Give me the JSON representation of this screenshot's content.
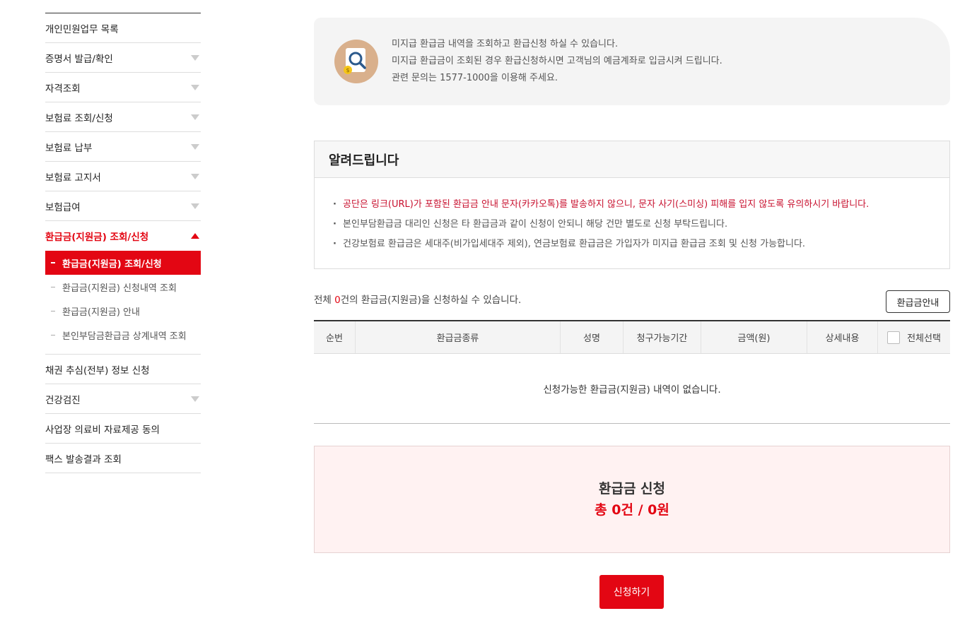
{
  "sidebar": {
    "items_top": [
      {
        "label": "개인민원업무 목록",
        "arrow": false
      },
      {
        "label": "증명서 발급/확인",
        "arrow": true
      },
      {
        "label": "자격조회",
        "arrow": true
      },
      {
        "label": "보험료 조회/신청",
        "arrow": true
      },
      {
        "label": "보험료 납부",
        "arrow": true
      },
      {
        "label": "보험료 고지서",
        "arrow": true
      },
      {
        "label": "보험급여",
        "arrow": true
      }
    ],
    "active": {
      "label": "환급금(지원금) 조회/신청"
    },
    "sub_items": [
      {
        "label": "환급금(지원금) 조회/신청"
      },
      {
        "label": "환급금(지원금) 신청내역 조회"
      },
      {
        "label": "환급금(지원금) 안내"
      },
      {
        "label": "본인부담금환급금 상계내역 조회"
      }
    ],
    "items_bottom": [
      {
        "label": "채권 추심(전부) 정보 신청",
        "arrow": false
      },
      {
        "label": "건강검진",
        "arrow": true
      },
      {
        "label": "사업장 의료비 자료제공 동의",
        "arrow": false
      },
      {
        "label": "팩스 발송결과 조회",
        "arrow": false
      }
    ]
  },
  "info": {
    "lines": [
      "미지급 환급금 내역을 조회하고 환급신청 하실 수 있습니다.",
      "미지급 환급금이 조회된 경우 환급신청하시면 고객님의 예금계좌로 입금시켜 드립니다.",
      "관련 문의는 1577-1000을 이용해 주세요."
    ]
  },
  "notice": {
    "title": "알려드립니다",
    "items": [
      "공단은 링크(URL)가 포함된 환급금 안내 문자(카카오톡)를 발송하지 않으니, 문자 사기(스미싱) 피해를 입지 않도록 유의하시기 바랍니다.",
      "본인부담환급금 대리인 신청은 타 환급금과 같이 신청이 안되니 해당 건만 별도로 신청 부탁드립니다.",
      "건강보험료 환급금은 세대주(비가입세대주 제외), 연금보험료 환급금은 가입자가 미지급 환급금 조회 및 신청 가능합니다."
    ]
  },
  "count": {
    "prefix": "전체 ",
    "number": "0",
    "suffix": "건의 환급금(지원금)을 신청하실 수 있습니다."
  },
  "guide_button": "환급금안내",
  "table": {
    "headers": [
      "순번",
      "환급금종류",
      "성명",
      "청구가능기간",
      "금액(원)",
      "상세내용",
      "전체선택"
    ],
    "empty_message": "신청가능한 환급금(지원금) 내역이 없습니다."
  },
  "summary": {
    "title": "환급금 신청",
    "total": "총 0건 / 0원"
  },
  "apply_button": "신청하기",
  "colors": {
    "accent": "#e30613",
    "summary_bg": "#fff2f2",
    "info_bg": "#f4f4f4"
  }
}
